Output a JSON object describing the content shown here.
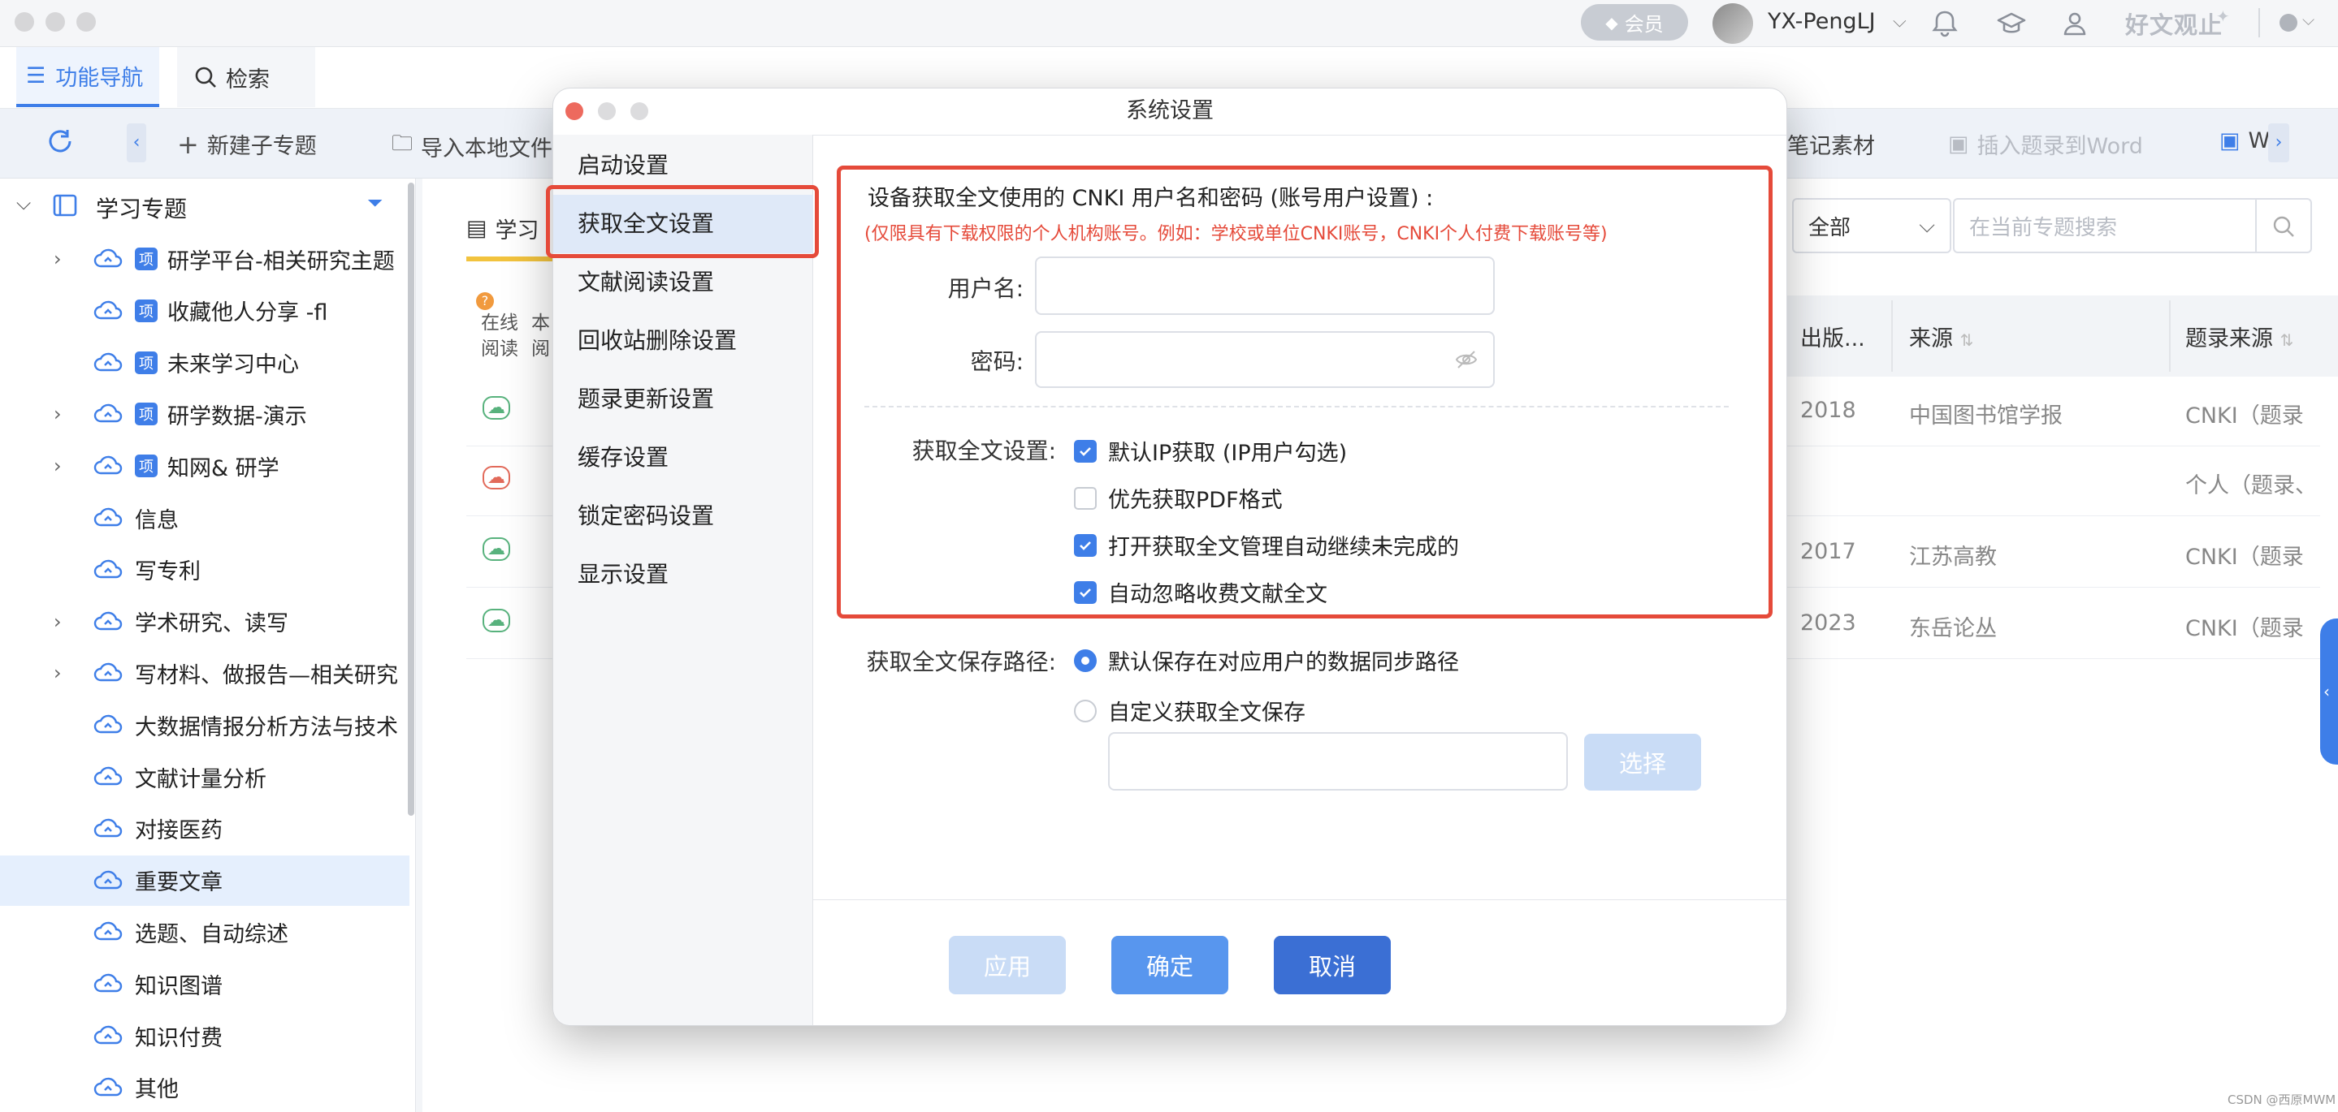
{
  "header": {
    "vip_label": "会员",
    "username": "YX-PengLJ",
    "brand_text": "好文观止",
    "nav_tabs": [
      {
        "label": "功能导航",
        "active": true
      },
      {
        "label": "检索",
        "active": false
      }
    ]
  },
  "toolbar": {
    "new_subtopic": "新建子专题",
    "import_local": "导入本地文件",
    "notes": "笔记素材",
    "insert_word": "插入题录到Word",
    "word_short": "W"
  },
  "sidebar": {
    "root_label": "学习专题",
    "items": [
      {
        "label": "研学平台-相关研究主题",
        "badge": "项",
        "expandable": true
      },
      {
        "label": "收藏他人分享 -fl",
        "badge": "项",
        "expandable": false
      },
      {
        "label": "未来学习中心",
        "badge": "项",
        "expandable": false
      },
      {
        "label": "研学数据-演示",
        "badge": "项",
        "expandable": true
      },
      {
        "label": "知网& 研学",
        "badge": "项",
        "expandable": true
      },
      {
        "label": "信息",
        "badge": "",
        "expandable": false
      },
      {
        "label": "写专利",
        "badge": "",
        "expandable": false
      },
      {
        "label": "学术研究、读写",
        "badge": "",
        "expandable": true
      },
      {
        "label": "写材料、做报告—相关研究",
        "badge": "",
        "expandable": true
      },
      {
        "label": "大数据情报分析方法与技术",
        "badge": "",
        "expandable": false
      },
      {
        "label": "文献计量分析",
        "badge": "",
        "expandable": false
      },
      {
        "label": "对接医药",
        "badge": "",
        "expandable": false
      },
      {
        "label": "重要文章",
        "badge": "",
        "expandable": false,
        "selected": true
      },
      {
        "label": "选题、自动综述",
        "badge": "",
        "expandable": false
      },
      {
        "label": "知识图谱",
        "badge": "",
        "expandable": false
      },
      {
        "label": "知识付费",
        "badge": "",
        "expandable": false
      },
      {
        "label": "其他",
        "badge": "",
        "expandable": false
      }
    ]
  },
  "content": {
    "tab_label": "学习",
    "filter_value": "全部",
    "search_placeholder": "在当前专题搜索",
    "col_online": "在线",
    "col_online2": "阅读",
    "col_local": "本",
    "col_local2": "阅",
    "headers": {
      "pubyear": "出版...",
      "source": "来源",
      "record_source": "题录来源"
    },
    "rows": [
      {
        "year": "2018",
        "source": "中国图书馆学报",
        "record": "CNKI（题录"
      },
      {
        "year": "",
        "source": "",
        "record": "个人（题录、"
      },
      {
        "year": "2017",
        "source": "江苏高教",
        "record": "CNKI（题录"
      },
      {
        "year": "2023",
        "source": "东岳论丛",
        "record": "CNKI（题录"
      }
    ]
  },
  "dialog": {
    "title": "系统设置",
    "menu": [
      {
        "label": "启动设置"
      },
      {
        "label": "获取全文设置",
        "selected": true
      },
      {
        "label": "文献阅读设置"
      },
      {
        "label": "回收站删除设置"
      },
      {
        "label": "题录更新设置"
      },
      {
        "label": "缓存设置"
      },
      {
        "label": "锁定密码设置"
      },
      {
        "label": "显示设置"
      }
    ],
    "account_heading": "设备获取全文使用的 CNKI 用户名和密码 (账号用户设置) :",
    "account_note": "(仅限具有下载权限的个人机构账号。例如：学校或单位CNKI账号，CNKI个人付费下载账号等)",
    "username_label": "用户名:",
    "username_value": "",
    "password_label": "密码:",
    "password_value": "",
    "fetch_label": "获取全文设置:",
    "fetch_options": [
      {
        "label": "默认IP获取 (IP用户勾选)",
        "checked": true
      },
      {
        "label": "优先获取PDF格式",
        "checked": false
      },
      {
        "label": "打开获取全文管理自动继续未完成的",
        "checked": true
      },
      {
        "label": "自动忽略收费文献全文",
        "checked": true
      }
    ],
    "path_label": "获取全文保存路径:",
    "path_options": [
      {
        "label": "默认保存在对应用户的数据同步路径",
        "selected": true
      },
      {
        "label": "自定义获取全文保存",
        "selected": false
      }
    ],
    "path_value": "",
    "choose_button": "选择",
    "apply_button": "应用",
    "ok_button": "确定",
    "cancel_button": "取消"
  },
  "footer": {
    "watermark": "CSDN @西原MWM"
  },
  "colors": {
    "accent": "#3e7ee8",
    "highlight_border": "#e54a3a",
    "note_red": "#e54a3a"
  }
}
